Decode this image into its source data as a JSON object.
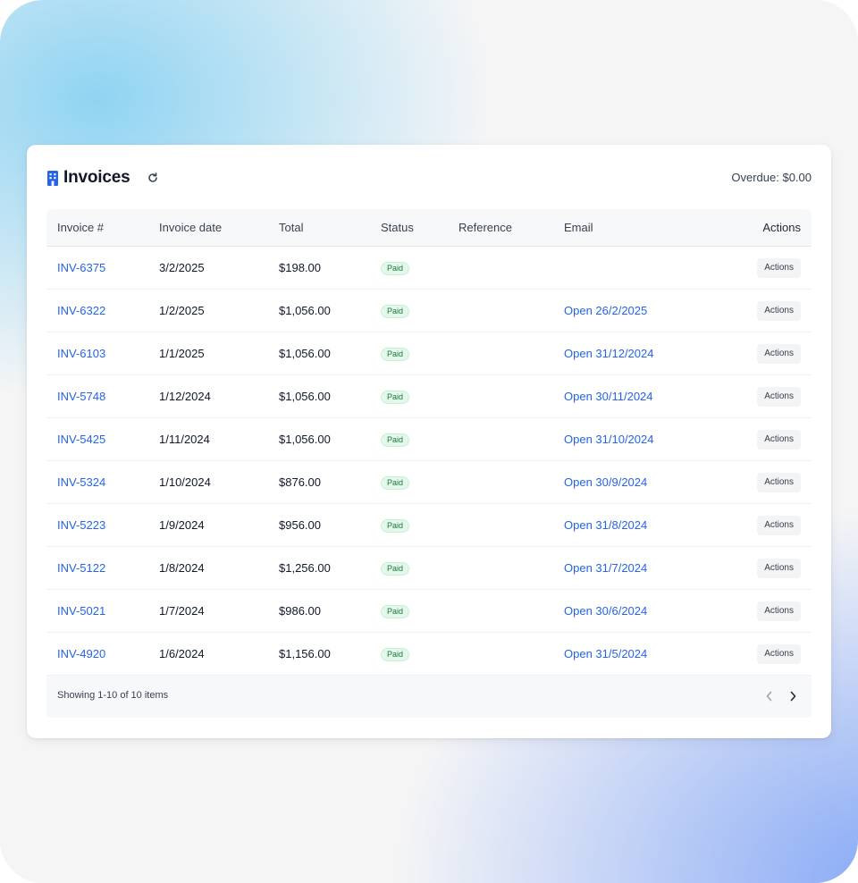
{
  "header": {
    "title": "Invoices",
    "overdue": "Overdue: $0.00"
  },
  "colors": {
    "accent": "#2563eb",
    "paid_badge_bg": "#e4f7ea",
    "paid_badge_text": "#15803d"
  },
  "icons": {
    "title": "building-icon",
    "refresh": "refresh-icon",
    "prev": "chevron-left-icon",
    "next": "chevron-right-icon"
  },
  "table": {
    "columns": {
      "invoice": "Invoice #",
      "date": "Invoice date",
      "total": "Total",
      "status": "Status",
      "reference": "Reference",
      "email": "Email",
      "actions": "Actions"
    },
    "rows": [
      {
        "invoice": "INV-6375",
        "date": "3/2/2025",
        "total": "$198.00",
        "status": "Paid",
        "reference": "",
        "email": "",
        "action": "Actions"
      },
      {
        "invoice": "INV-6322",
        "date": "1/2/2025",
        "total": "$1,056.00",
        "status": "Paid",
        "reference": "",
        "email": "Open 26/2/2025",
        "action": "Actions"
      },
      {
        "invoice": "INV-6103",
        "date": "1/1/2025",
        "total": "$1,056.00",
        "status": "Paid",
        "reference": "",
        "email": "Open 31/12/2024",
        "action": "Actions"
      },
      {
        "invoice": "INV-5748",
        "date": "1/12/2024",
        "total": "$1,056.00",
        "status": "Paid",
        "reference": "",
        "email": "Open 30/11/2024",
        "action": "Actions"
      },
      {
        "invoice": "INV-5425",
        "date": "1/11/2024",
        "total": "$1,056.00",
        "status": "Paid",
        "reference": "",
        "email": "Open 31/10/2024",
        "action": "Actions"
      },
      {
        "invoice": "INV-5324",
        "date": "1/10/2024",
        "total": "$876.00",
        "status": "Paid",
        "reference": "",
        "email": "Open 30/9/2024",
        "action": "Actions"
      },
      {
        "invoice": "INV-5223",
        "date": "1/9/2024",
        "total": "$956.00",
        "status": "Paid",
        "reference": "",
        "email": "Open 31/8/2024",
        "action": "Actions"
      },
      {
        "invoice": "INV-5122",
        "date": "1/8/2024",
        "total": "$1,256.00",
        "status": "Paid",
        "reference": "",
        "email": "Open 31/7/2024",
        "action": "Actions"
      },
      {
        "invoice": "INV-5021",
        "date": "1/7/2024",
        "total": "$986.00",
        "status": "Paid",
        "reference": "",
        "email": "Open 30/6/2024",
        "action": "Actions"
      },
      {
        "invoice": "INV-4920",
        "date": "1/6/2024",
        "total": "$1,156.00",
        "status": "Paid",
        "reference": "",
        "email": "Open 31/5/2024",
        "action": "Actions"
      }
    ]
  },
  "footer": {
    "showing": "Showing 1-10 of 10 items"
  }
}
